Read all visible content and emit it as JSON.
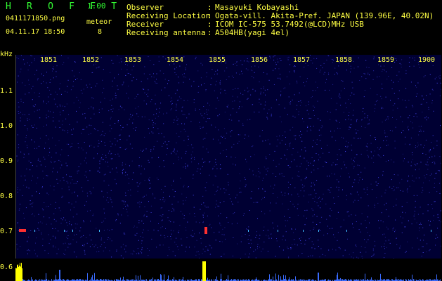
{
  "header": {
    "title": "H R O F F T",
    "version": "1.00",
    "filename": "0411171850.png",
    "datetime": "04.11.17 18:50",
    "meteor_label": "meteor",
    "meteor_count": "8"
  },
  "info": {
    "labels": [
      "Observer",
      "Receiving Location",
      "Receiver",
      "Receiving antenna"
    ],
    "colons": [
      ":",
      ":",
      ":",
      ":"
    ],
    "values": [
      "Masayuki Kobayashi",
      "Ogata-vill. Akita-Pref. JAPAN (139.96E, 40.02N)",
      "ICOM IC-575 53.7492(@LCD)MHz USB",
      "A504HB(yagi 4el)"
    ]
  },
  "spectrogram": {
    "y_unit": "kHz",
    "y_ticks": [
      "1.1",
      "1.0",
      "0.9",
      "0.8",
      "0.7",
      "0.6"
    ],
    "x_ticks": [
      "1851",
      "1852",
      "1853",
      "1854",
      "1855",
      "1856",
      "1857",
      "1858",
      "1859",
      "1900"
    ],
    "background_color": "#000033",
    "noise_color": "#4a4aff",
    "echo_color_core": "#ff3030",
    "echo_color_edge": "#40c0ff",
    "bottom_trace_color": "#ffff00"
  }
}
